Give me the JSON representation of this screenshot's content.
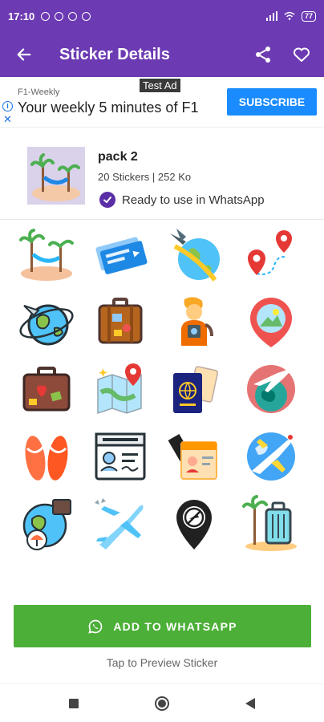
{
  "status_bar": {
    "time": "17:10",
    "battery": "77"
  },
  "app_bar": {
    "title": "Sticker Details",
    "back_icon": "arrow-left-icon",
    "share_icon": "share-icon",
    "favorite_icon": "heart-outline-icon"
  },
  "ad": {
    "badge": "Test Ad",
    "brand": "F1-Weekly",
    "headline": "Your weekly 5 minutes of F1",
    "cta": "SUBSCRIBE"
  },
  "pack": {
    "name": "pack 2",
    "meta": "20 Stickers | 252 Ko",
    "status": "Ready to use in WhatsApp"
  },
  "stickers": [
    {
      "icon": "beach-hammock-icon"
    },
    {
      "icon": "plane-tickets-icon"
    },
    {
      "icon": "plane-globe-icon"
    },
    {
      "icon": "route-pins-icon"
    },
    {
      "icon": "globe-plane-icon"
    },
    {
      "icon": "suitcase-icon"
    },
    {
      "icon": "traveler-icon"
    },
    {
      "icon": "location-pin-photo-icon"
    },
    {
      "icon": "luggage-bag-icon"
    },
    {
      "icon": "map-pin-icon"
    },
    {
      "icon": "passport-tickets-icon"
    },
    {
      "icon": "globe-plane-circle-icon"
    },
    {
      "icon": "flip-flops-icon"
    },
    {
      "icon": "passport-card-icon"
    },
    {
      "icon": "id-ticket-icon"
    },
    {
      "icon": "plane-globe-round-icon"
    },
    {
      "icon": "globe-luggage-icon"
    },
    {
      "icon": "airplane-icon"
    },
    {
      "icon": "no-map-pin-icon"
    },
    {
      "icon": "beach-luggage-icon"
    }
  ],
  "footer": {
    "add_button": "ADD TO WHATSAPP",
    "hint": "Tap to Preview Sticker"
  },
  "colors": {
    "primary": "#6c3ab3",
    "whatsapp_green": "#4caf37",
    "ad_blue": "#1a8cff"
  }
}
